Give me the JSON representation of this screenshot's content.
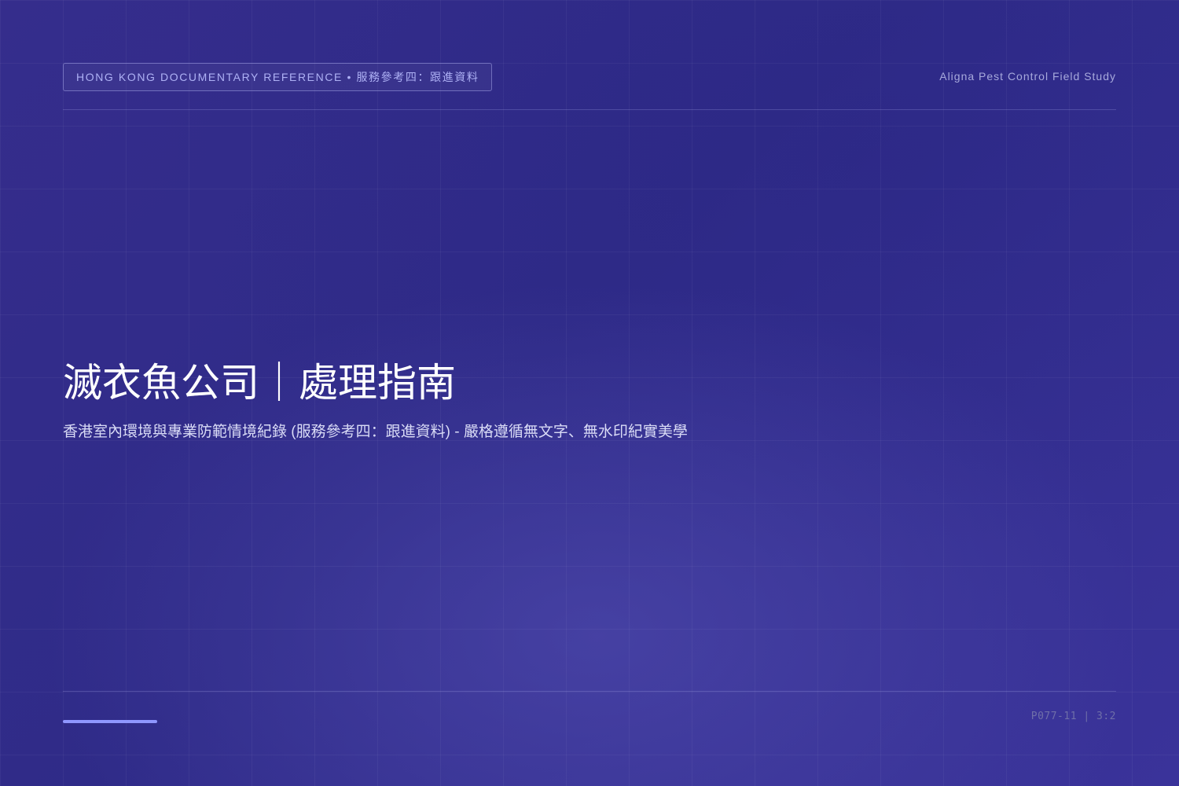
{
  "header": {
    "tag": "HONG KONG DOCUMENTARY REFERENCE • 服務參考四：跟進資料",
    "brand": "Aligna Pest Control Field Study"
  },
  "main": {
    "title": "滅衣魚公司｜處理指南",
    "subtitle": "香港室內環境與專業防範情境紀錄 (服務參考四：跟進資料) - 嚴格遵循無文字、無水印紀實美學"
  },
  "footer": {
    "code": "P077-11 | 3:2"
  },
  "colors": {
    "background": "#322a8a",
    "accent": "#8f97ff",
    "title": "#ffffff",
    "tag_text": "#aeb1f5"
  }
}
